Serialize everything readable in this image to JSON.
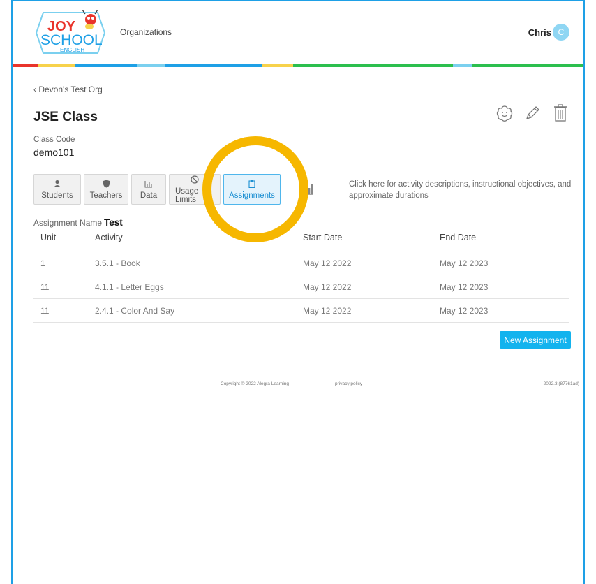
{
  "header": {
    "logo": {
      "line1": "JOY",
      "line2": "SCHOOL",
      "line3": "ENGLISH"
    },
    "nav_organizations": "Organizations",
    "user_name": "Chris",
    "avatar_initial": "C",
    "color_stripes": [
      "#e9342b",
      "#f7d24b",
      "#1ea0e6",
      "#7bd0ef",
      "#1ea0e6",
      "#f7d24b",
      "#2cbf4e",
      "#7bd0ef",
      "#2cbf4e"
    ]
  },
  "breadcrumb": {
    "back_label": "Devon's Test Org"
  },
  "page_title": "JSE Class",
  "class_code": {
    "label": "Class Code",
    "value": "demo101"
  },
  "tabs": [
    {
      "label": "Students",
      "icon": "person-icon"
    },
    {
      "label": "Teachers",
      "icon": "shield-icon"
    },
    {
      "label": "Data",
      "icon": "bar-chart-icon"
    },
    {
      "label": "Usage Limits",
      "icon": "block-icon"
    },
    {
      "label": "Assignments",
      "icon": "clipboard-icon"
    }
  ],
  "hint_text": "Click here for activity descriptions, instructional objectives, and approximate durations",
  "assignment": {
    "label": "Assignment Name",
    "value": "Test"
  },
  "table": {
    "headers": [
      "Unit",
      "Activity",
      "Start Date",
      "End Date"
    ],
    "rows": [
      [
        "1",
        "3.5.1 - Book",
        "May 12 2022",
        "May 12 2023"
      ],
      [
        "11",
        "4.1.1 - Letter Eggs",
        "May 12 2022",
        "May 12 2023"
      ],
      [
        "11",
        "2.4.1 - Color And Say",
        "May 12 2022",
        "May 12 2023"
      ]
    ]
  },
  "new_assignment_label": "New Assignment",
  "footer": {
    "copyright": "Copyright © 2022 Alegra Learning",
    "privacy": "privacy policy",
    "version": "2022.3 (87761ad)"
  },
  "colors": {
    "accent": "#13b3ee",
    "highlight": "#f6b700",
    "frame": "#1ea0e6"
  }
}
